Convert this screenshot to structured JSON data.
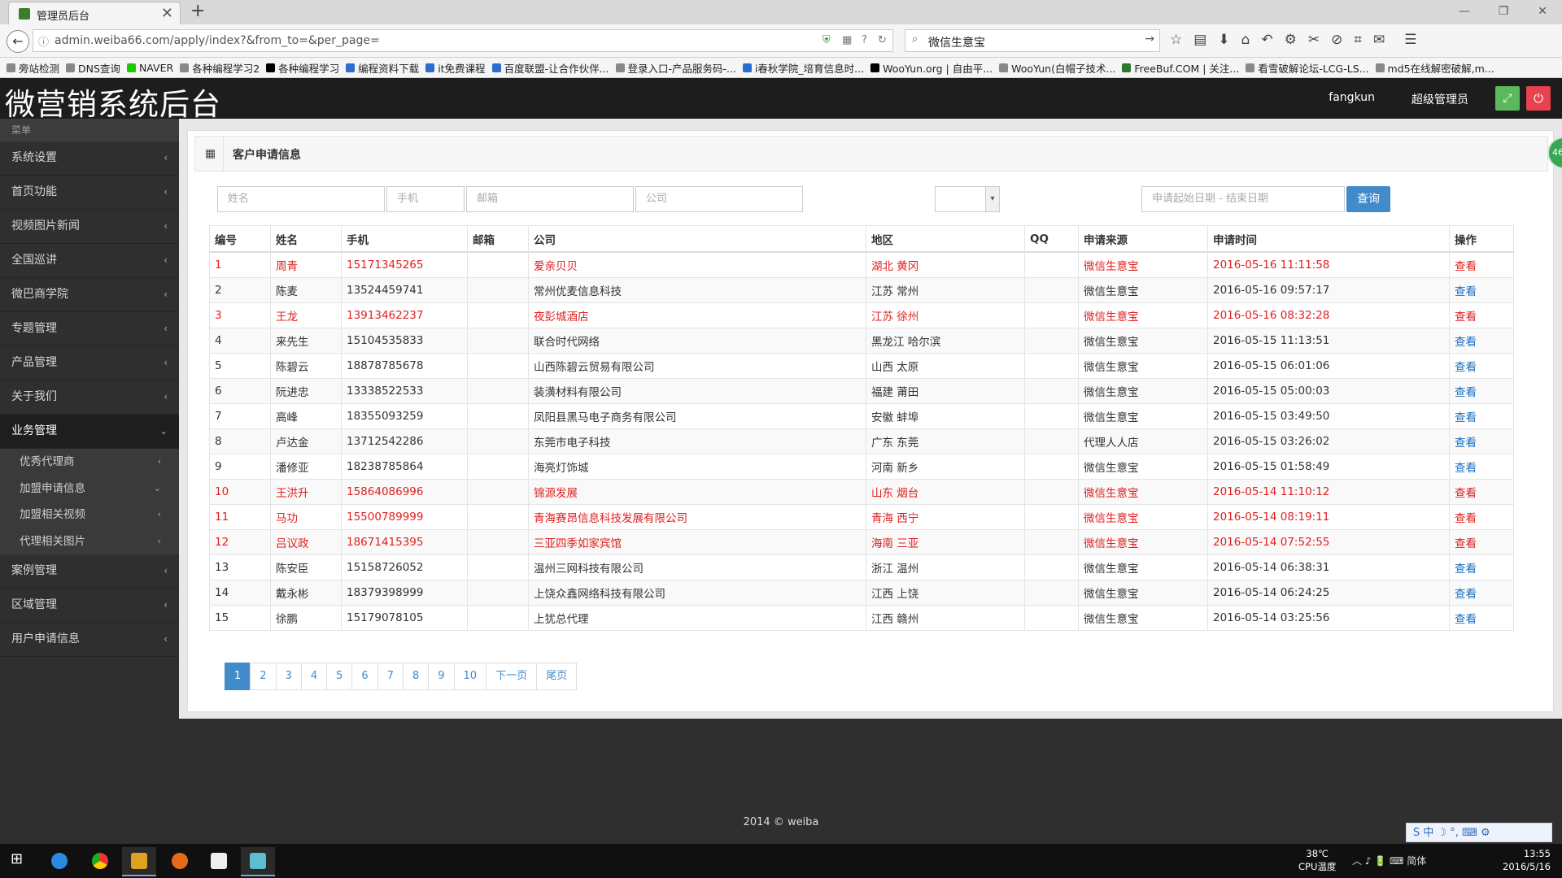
{
  "browser": {
    "tab_title": "管理员后台",
    "url": "admin.weiba66.com/apply/index?&from_to=&per_page=",
    "search_query": "微信生意宝",
    "bookmarks": [
      "旁站检测",
      "DNS查询",
      "NAVER",
      "各种编程学习2",
      "各种编程学习",
      "编程资料下载",
      "it免费课程",
      "百度联盟-让合作伙伴...",
      "登录入口-产品服务码-...",
      "i春秋学院_培育信息时...",
      "WooYun.org | 自由平...",
      "WooYun(白帽子技术...",
      "FreeBuf.COM | 关注...",
      "看雪破解论坛-LCG-LS...",
      "md5在线解密破解,m..."
    ]
  },
  "header": {
    "logo": "微营销系统后台",
    "username": "fangkun",
    "role": "超级管理员"
  },
  "sidebar": {
    "heading": "菜单",
    "items_top": [
      "系统设置",
      "首页功能",
      "视频图片新闻",
      "全国巡讲",
      "微巴商学院",
      "专题管理",
      "产品管理",
      "关于我们"
    ],
    "active": "业务管理",
    "sub": [
      "优秀代理商",
      "加盟申请信息",
      "加盟相关视频",
      "代理相关图片"
    ],
    "items_bottom": [
      "案例管理",
      "区域管理",
      "用户申请信息"
    ]
  },
  "panel": {
    "title": "客户申请信息",
    "filters": {
      "name": "姓名",
      "phone": "手机",
      "email": "邮箱",
      "company": "公司",
      "date_range": "申请起始日期 - 结束日期"
    },
    "query_button": "查询"
  },
  "table": {
    "columns": [
      "编号",
      "姓名",
      "手机",
      "邮箱",
      "公司",
      "地区",
      "QQ",
      "申请来源",
      "申请时间",
      "操作"
    ],
    "rows": [
      {
        "id": "1",
        "name": "周青",
        "phone": "15171345265",
        "email": "",
        "company": "爱亲贝贝",
        "region": "湖北 黄冈",
        "qq": "",
        "source": "微信生意宝",
        "time": "2016-05-16 11:11:58",
        "op": "查看",
        "hl": true
      },
      {
        "id": "2",
        "name": "陈麦",
        "phone": "13524459741",
        "email": "",
        "company": "常州优麦信息科技",
        "region": "江苏 常州",
        "qq": "",
        "source": "微信生意宝",
        "time": "2016-05-16 09:57:17",
        "op": "查看",
        "hl": false
      },
      {
        "id": "3",
        "name": "王龙",
        "phone": "13913462237",
        "email": "",
        "company": "夜彭城酒店",
        "region": "江苏 徐州",
        "qq": "",
        "source": "微信生意宝",
        "time": "2016-05-16 08:32:28",
        "op": "查看",
        "hl": true
      },
      {
        "id": "4",
        "name": "来先生",
        "phone": "15104535833",
        "email": "",
        "company": "联合时代网络",
        "region": "黑龙江 哈尔滨",
        "qq": "",
        "source": "微信生意宝",
        "time": "2016-05-15 11:13:51",
        "op": "查看",
        "hl": false
      },
      {
        "id": "5",
        "name": "陈碧云",
        "phone": "18878785678",
        "email": "",
        "company": "山西陈碧云贸易有限公司",
        "region": "山西 太原",
        "qq": "",
        "source": "微信生意宝",
        "time": "2016-05-15 06:01:06",
        "op": "查看",
        "hl": false
      },
      {
        "id": "6",
        "name": "阮进忠",
        "phone": "13338522533",
        "email": "",
        "company": "装潢材料有限公司",
        "region": "福建 莆田",
        "qq": "",
        "source": "微信生意宝",
        "time": "2016-05-15 05:00:03",
        "op": "查看",
        "hl": false
      },
      {
        "id": "7",
        "name": "高峰",
        "phone": "18355093259",
        "email": "",
        "company": "凤阳县黑马电子商务有限公司",
        "region": "安徽 蚌埠",
        "qq": "",
        "source": "微信生意宝",
        "time": "2016-05-15 03:49:50",
        "op": "查看",
        "hl": false
      },
      {
        "id": "8",
        "name": "卢达金",
        "phone": "13712542286",
        "email": "",
        "company": "东莞市电子科技",
        "region": "广东 东莞",
        "qq": "",
        "source": "代理人人店",
        "time": "2016-05-15 03:26:02",
        "op": "查看",
        "hl": false
      },
      {
        "id": "9",
        "name": "潘修亚",
        "phone": "18238785864",
        "email": "",
        "company": "海亮灯饰城",
        "region": "河南 新乡",
        "qq": "",
        "source": "微信生意宝",
        "time": "2016-05-15 01:58:49",
        "op": "查看",
        "hl": false
      },
      {
        "id": "10",
        "name": "王洪升",
        "phone": "15864086996",
        "email": "",
        "company": "锦源发展",
        "region": "山东 烟台",
        "qq": "",
        "source": "微信生意宝",
        "time": "2016-05-14 11:10:12",
        "op": "查看",
        "hl": true
      },
      {
        "id": "11",
        "name": "马功",
        "phone": "15500789999",
        "email": "",
        "company": "青海赛昂信息科技发展有限公司",
        "region": "青海 西宁",
        "qq": "",
        "source": "微信生意宝",
        "time": "2016-05-14 08:19:11",
        "op": "查看",
        "hl": true
      },
      {
        "id": "12",
        "name": "吕议政",
        "phone": "18671415395",
        "email": "",
        "company": "三亚四季如家宾馆",
        "region": "海南 三亚",
        "qq": "",
        "source": "微信生意宝",
        "time": "2016-05-14 07:52:55",
        "op": "查看",
        "hl": true
      },
      {
        "id": "13",
        "name": "陈安臣",
        "phone": "15158726052",
        "email": "",
        "company": "温州三网科技有限公司",
        "region": "浙江 温州",
        "qq": "",
        "source": "微信生意宝",
        "time": "2016-05-14 06:38:31",
        "op": "查看",
        "hl": false
      },
      {
        "id": "14",
        "name": "戴永彬",
        "phone": "18379398999",
        "email": "",
        "company": "上饶众鑫网络科技有限公司",
        "region": "江西 上饶",
        "qq": "",
        "source": "微信生意宝",
        "time": "2016-05-14 06:24:25",
        "op": "查看",
        "hl": false
      },
      {
        "id": "15",
        "name": "徐鹏",
        "phone": "15179078105",
        "email": "",
        "company": "上犹总代理",
        "region": "江西 赣州",
        "qq": "",
        "source": "微信生意宝",
        "time": "2016-05-14 03:25:56",
        "op": "查看",
        "hl": false
      }
    ]
  },
  "pagination": {
    "pages": [
      "1",
      "2",
      "3",
      "4",
      "5",
      "6",
      "7",
      "8",
      "9",
      "10"
    ],
    "current": "1",
    "next": "下一页",
    "last": "尾页"
  },
  "footer": "2014 © weiba",
  "badge": "46",
  "taskbar": {
    "temp": "38℃",
    "temp_label": "CPU温度",
    "ime": "简体",
    "time": "13:55",
    "date": "2016/5/16"
  },
  "colors": {
    "highlight_red": "#e02020",
    "primary_blue": "#428bca",
    "sidebar_bg": "#2f2f2f"
  }
}
